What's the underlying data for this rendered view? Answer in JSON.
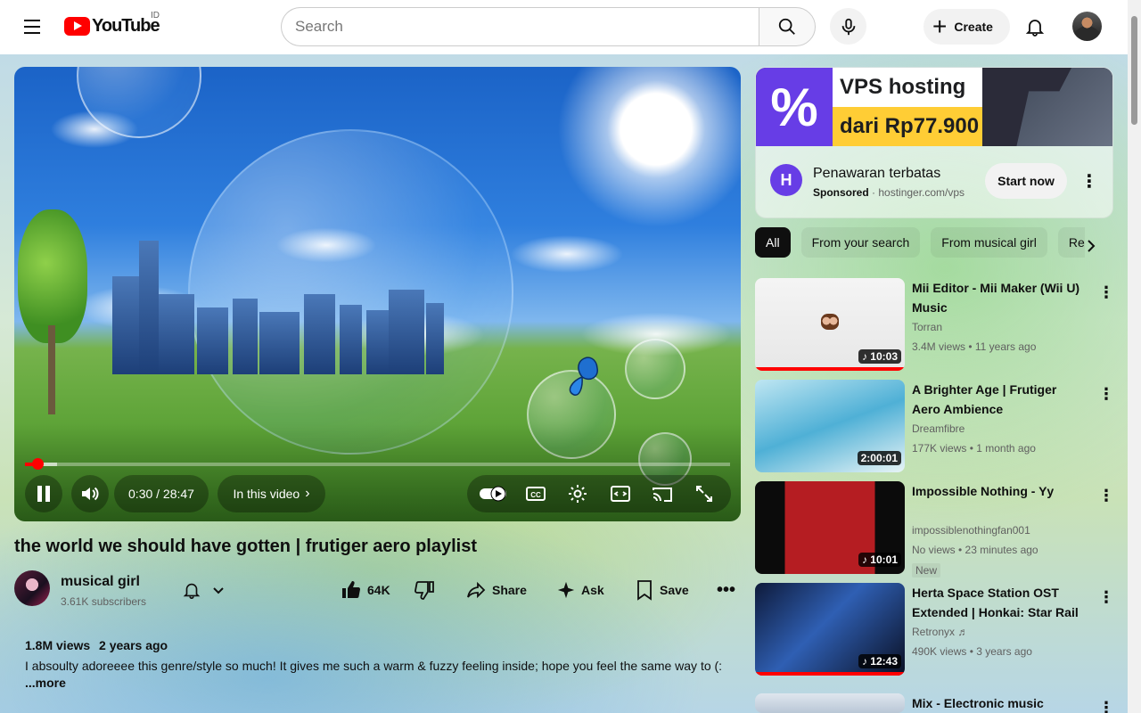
{
  "header": {
    "logo_text": "YouTube",
    "country_code": "ID",
    "search_placeholder": "Search",
    "create_label": "Create"
  },
  "player": {
    "progress_fraction": 0.0175,
    "buffer_fraction": 0.045,
    "time_display": "0:30 / 28:47",
    "in_this_video_label": "In this video"
  },
  "video": {
    "title": "the world we should have gotten | frutiger aero playlist",
    "channel_name": "musical girl",
    "subscribers": "3.61K subscribers",
    "likes": "64K",
    "share_label": "Share",
    "ask_label": "Ask",
    "save_label": "Save",
    "views": "1.8M views",
    "age": "2 years ago",
    "description": "I absoulty adoreeee this genre/style so much! It gives me such a warm & fuzzy feeling inside; hope you feel the same way to (:",
    "more_label": "...more"
  },
  "ad": {
    "banner_line1": "VPS hosting",
    "banner_line2": "dari Rp77.900",
    "banner_symbol": "%",
    "title": "Penawaran terbatas",
    "sponsored_label": "Sponsored",
    "domain": "hostinger.com/vps",
    "cta_label": "Start now"
  },
  "chips": [
    {
      "label": "All",
      "active": true
    },
    {
      "label": "From your search",
      "active": false
    },
    {
      "label": "From musical girl",
      "active": false
    },
    {
      "label": "Related",
      "active": false
    }
  ],
  "recommendations": [
    {
      "title": "Mii Editor - Mii Maker (Wii U) Music",
      "channel": "Torran",
      "stats": "3.4M views • 11 years ago",
      "duration": "10:03",
      "badge": ""
    },
    {
      "title": "A Brighter Age | Frutiger Aero Ambience",
      "channel": "Dreamfibre",
      "stats": "177K views • 1 month ago",
      "duration": "2:00:01",
      "badge": ""
    },
    {
      "title": "Impossible Nothing - Yy",
      "channel": "impossiblenothingfan001",
      "stats": "No views • 23 minutes ago",
      "duration": "10:01",
      "badge": "New"
    },
    {
      "title": "Herta Space Station OST Extended | Honkai: Star Rail",
      "channel": "Retronyx ♬",
      "stats": "490K views • 3 years ago",
      "duration": "12:43",
      "badge": ""
    },
    {
      "title": "Mix - Electronic music",
      "channel": "",
      "stats": "",
      "duration": "",
      "badge": ""
    }
  ],
  "colors": {
    "brand_red": "#ff0000",
    "hostinger_purple": "#673de6",
    "hostinger_yellow": "#ffcd35"
  }
}
